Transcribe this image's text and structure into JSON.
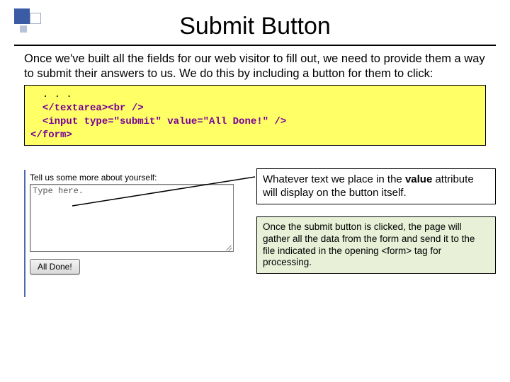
{
  "title": "Submit Button",
  "intro": "Once we've built all the fields for our web visitor to fill out, we need to provide them a way to submit their answers to us.  We do this by including a button for them to click:",
  "code": {
    "l1": ". . .",
    "l2a": "</textarea>",
    "l2b": "<br />",
    "l3a": "<input type=\"submit\" value=\"All Done!\" />",
    "l4a": "</form>"
  },
  "preview": {
    "label": "Tell us some more about yourself:",
    "placeholder": "Type here.",
    "button": "All Done!"
  },
  "note1_pre": "Whatever text we place in the ",
  "note1_bold": "value",
  "note1_post": " attribute will display on the button itself.",
  "note2": "Once the submit button is clicked, the page will gather all the data from the form and send it to the file indicated in the opening <form> tag for processing."
}
